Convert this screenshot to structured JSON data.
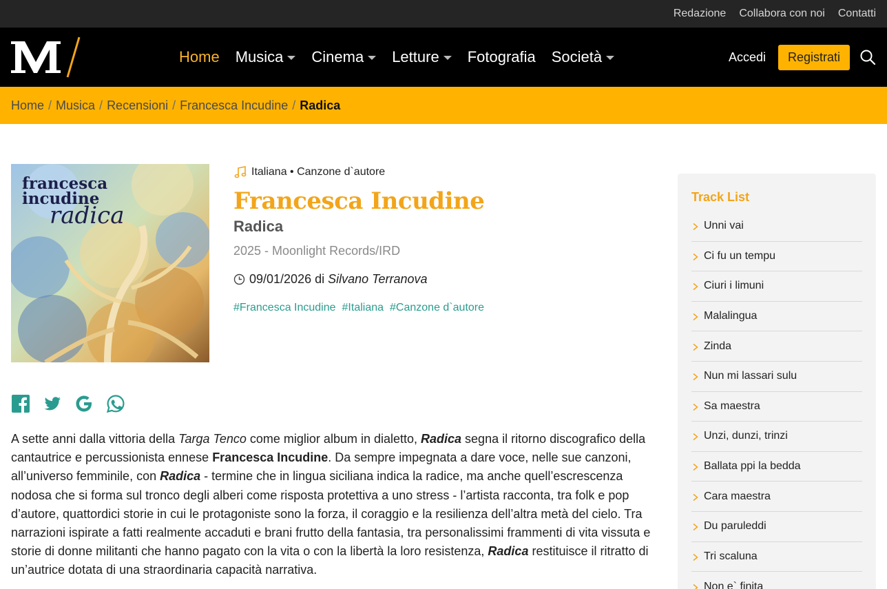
{
  "topbar": {
    "links": [
      "Redazione",
      "Collabora con noi",
      "Contatti"
    ]
  },
  "nav": {
    "items": [
      {
        "label": "Home",
        "active": true,
        "dropdown": false
      },
      {
        "label": "Musica",
        "active": false,
        "dropdown": true
      },
      {
        "label": "Cinema",
        "active": false,
        "dropdown": true
      },
      {
        "label": "Letture",
        "active": false,
        "dropdown": true
      },
      {
        "label": "Fotografia",
        "active": false,
        "dropdown": false
      },
      {
        "label": "Società",
        "active": false,
        "dropdown": true
      }
    ],
    "login_label": "Accedi",
    "register_label": "Registrati"
  },
  "breadcrumb": {
    "items": [
      "Home",
      "Musica",
      "Recensioni",
      "Francesca Incudine"
    ],
    "current": "Radica"
  },
  "cover": {
    "line1": "francesca",
    "line2": "incudine",
    "line3": "radica"
  },
  "album": {
    "genre": "Italiana • Canzone d`autore",
    "artist": "Francesca Incudine",
    "title": "Radica",
    "release": "2025 - Moonlight Records/IRD",
    "date": "09/01/2026 di",
    "author": "Silvano Terranova",
    "tags": [
      "#Francesca Incudine",
      "#Italiana",
      "#Canzone d`autore"
    ]
  },
  "share": [
    "facebook-icon",
    "twitter-icon",
    "google-icon",
    "whatsapp-icon"
  ],
  "article": {
    "p1": "A sette anni dalla vittoria della ",
    "p1_em": "Targa Tenco",
    "p2": " come miglior album in dialetto, ",
    "p2_bem": "Radica",
    "p3": " segna il ritorno discografico della cantautrice e percussionista ennese ",
    "p3_b": "Francesca Incudine",
    "p4": ". Da sempre impegnata a dare voce, nelle sue canzoni, all’universo femminile, con ",
    "p4_bem": "Radica",
    "p5": " - termine che in lingua siciliana indica la radice, ma anche quell’escrescenza nodosa che si forma sul tronco degli alberi come risposta protettiva a uno stress - l’artista racconta, tra folk e pop d’autore, quattordici storie in cui le protagoniste sono la forza, il coraggio e la resilienza dell’altra metà del cielo.  Tra narrazioni ispirate a fatti realmente accaduti e brani frutto della fantasia, tra personalissimi frammenti di vita vissuta e storie di donne militanti che hanno pagato con la vita o con la libertà la loro resistenza, ",
    "p5_bem": "Radica",
    "p6": " restituisce il ritratto di un’autrice dotata di una straordinaria capacità narrativa."
  },
  "tracklist": {
    "title": "Track List",
    "tracks": [
      "Unni vai",
      "Ci fu un tempu",
      "Ciuri i limuni",
      "Malalingua",
      "Zinda",
      "Nun mi lassari sulu",
      "Sa maestra",
      "Unzi, dunzi, trinzi",
      "Ballata ppi la bedda",
      "Cara maestra",
      "Du paruleddi",
      "Tri scaluna",
      "Non e` finita"
    ]
  },
  "colors": {
    "accent": "#ffb300",
    "artist": "#f2a51a",
    "tag": "#2a9c8f"
  }
}
